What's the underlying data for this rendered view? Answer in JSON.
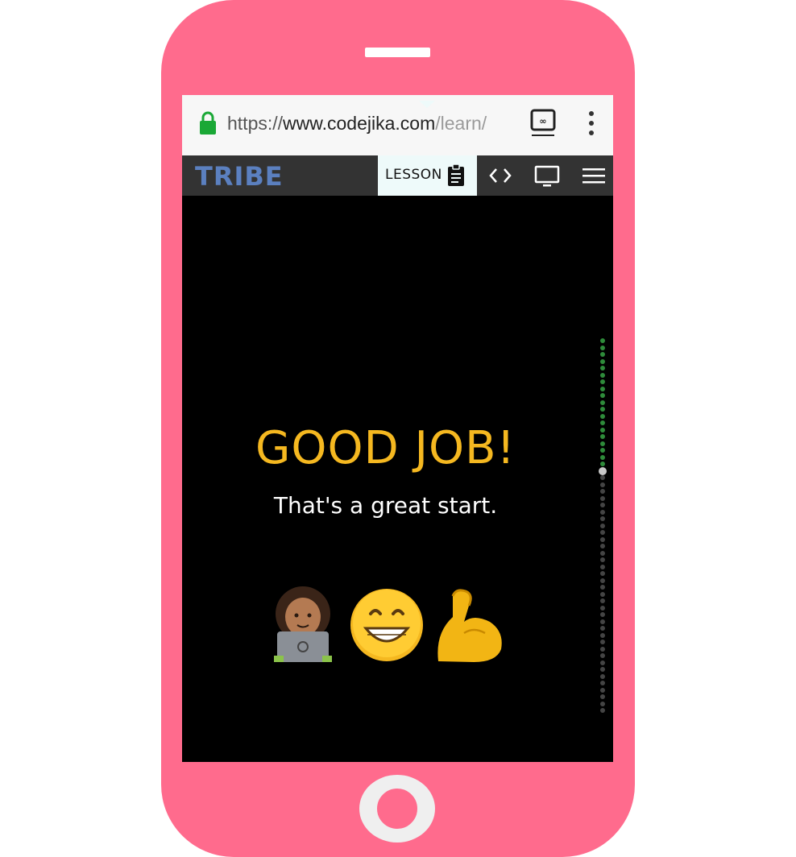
{
  "browser": {
    "url_scheme": "https://",
    "url_host": "www.codejika.com",
    "url_path": "/learn/",
    "lock_icon": "lock-icon",
    "tab_icon": "tab-switcher-icon",
    "menu_icon": "more-vert-icon"
  },
  "navbar": {
    "logo_text": "TRIBE",
    "lesson_label": "LESSON",
    "lesson_icon": "clipboard-icon",
    "code_icon": "code-brackets-icon",
    "preview_icon": "monitor-icon",
    "menu_icon": "hamburger-icon"
  },
  "content": {
    "headline": "GOOD JOB!",
    "subline": "That's a great start.",
    "emojis": [
      "woman-technologist",
      "grinning-face",
      "flexed-biceps"
    ]
  },
  "progress": {
    "completed_steps": 19,
    "current_step": 20,
    "total_steps": 55
  },
  "colors": {
    "phone": "#ff6b8d",
    "headline": "#f5b820",
    "progress_done": "#2e8b3a",
    "progress_todo": "#444444",
    "progress_current": "#c8c8c8",
    "navbar": "#333333",
    "lesson_tab": "#eefafa"
  }
}
